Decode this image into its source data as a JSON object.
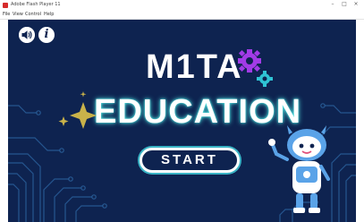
{
  "window": {
    "title": "Adobe Flash Player 11",
    "controls": {
      "minimize": "–",
      "maximize": "□",
      "close": "×"
    }
  },
  "menu": [
    "File",
    "View",
    "Control",
    "Help"
  ],
  "game": {
    "title_line1": "M1TA",
    "title_line2": "EDUCATION",
    "start_label": "START"
  },
  "icons": {
    "sound": "speaker-icon",
    "info": "info-icon",
    "info_glyph": "i",
    "gears": [
      "purple-gear-icon",
      "cyan-gear-icon"
    ],
    "sparkle": "sparkle-icon",
    "mascot": "robot-mascot"
  },
  "colors": {
    "background": "#0e2350",
    "accent_cyan": "#4fe8e4",
    "gear_purple": "#a23be6",
    "gear_cyan": "#2fc3d4",
    "sparkle_gold": "#c9b24a",
    "robot_blue": "#5aa3e8"
  }
}
